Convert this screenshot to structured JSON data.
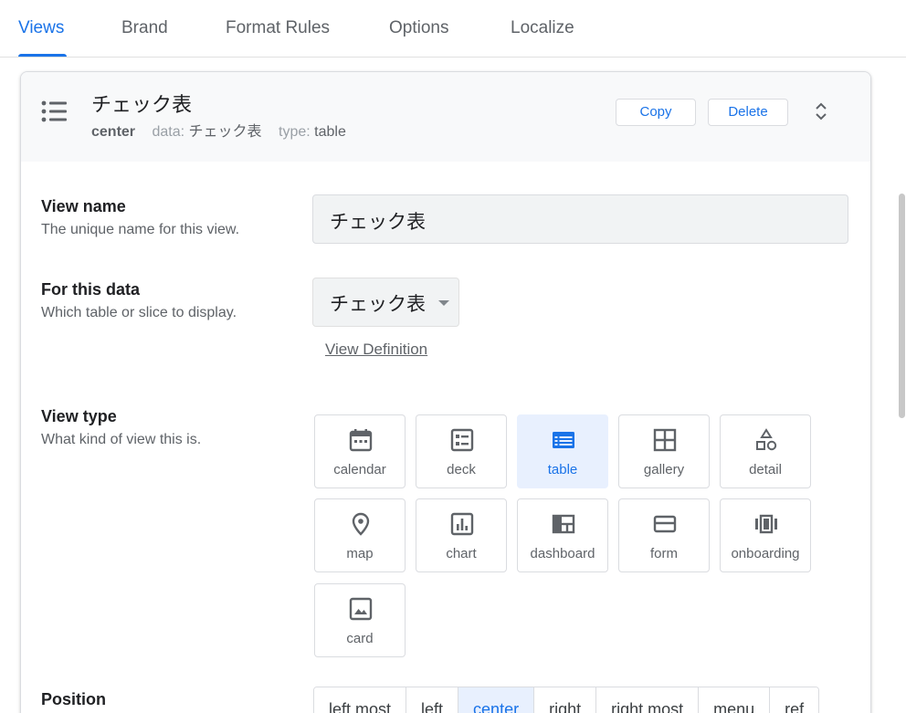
{
  "tabs": [
    {
      "label": "Views"
    },
    {
      "label": "Brand"
    },
    {
      "label": "Format Rules"
    },
    {
      "label": "Options"
    },
    {
      "label": "Localize"
    }
  ],
  "view": {
    "title": "チェック表",
    "position": "center",
    "data_label": "data:",
    "data_value": "チェック表",
    "type_label": "type:",
    "type_value": "table",
    "copy_label": "Copy",
    "delete_label": "Delete"
  },
  "form": {
    "view_name": {
      "title": "View name",
      "desc": "The unique name for this view.",
      "value": "チェック表"
    },
    "for_data": {
      "title": "For this data",
      "desc": "Which table or slice to display.",
      "value": "チェック表",
      "link": "View Definition"
    },
    "view_type": {
      "title": "View type",
      "desc": "What kind of view this is.",
      "selected": "table",
      "options": [
        {
          "label": "calendar",
          "icon": "calendar-icon"
        },
        {
          "label": "deck",
          "icon": "deck-icon"
        },
        {
          "label": "table",
          "icon": "table-icon"
        },
        {
          "label": "gallery",
          "icon": "gallery-icon"
        },
        {
          "label": "detail",
          "icon": "detail-icon"
        },
        {
          "label": "map",
          "icon": "map-pin-icon"
        },
        {
          "label": "chart",
          "icon": "chart-icon"
        },
        {
          "label": "dashboard",
          "icon": "dashboard-icon"
        },
        {
          "label": "form",
          "icon": "form-icon"
        },
        {
          "label": "onboarding",
          "icon": "onboarding-icon"
        },
        {
          "label": "card",
          "icon": "image-icon"
        }
      ]
    },
    "position": {
      "title": "Position",
      "selected": "center",
      "options": [
        "left most",
        "left",
        "center",
        "right",
        "right most",
        "menu",
        "ref"
      ]
    }
  },
  "colors": {
    "accent": "#1a73e8",
    "selected_bg": "#e8f0fe",
    "header_bg": "#f8f9fa",
    "icon": "#5f6368"
  }
}
